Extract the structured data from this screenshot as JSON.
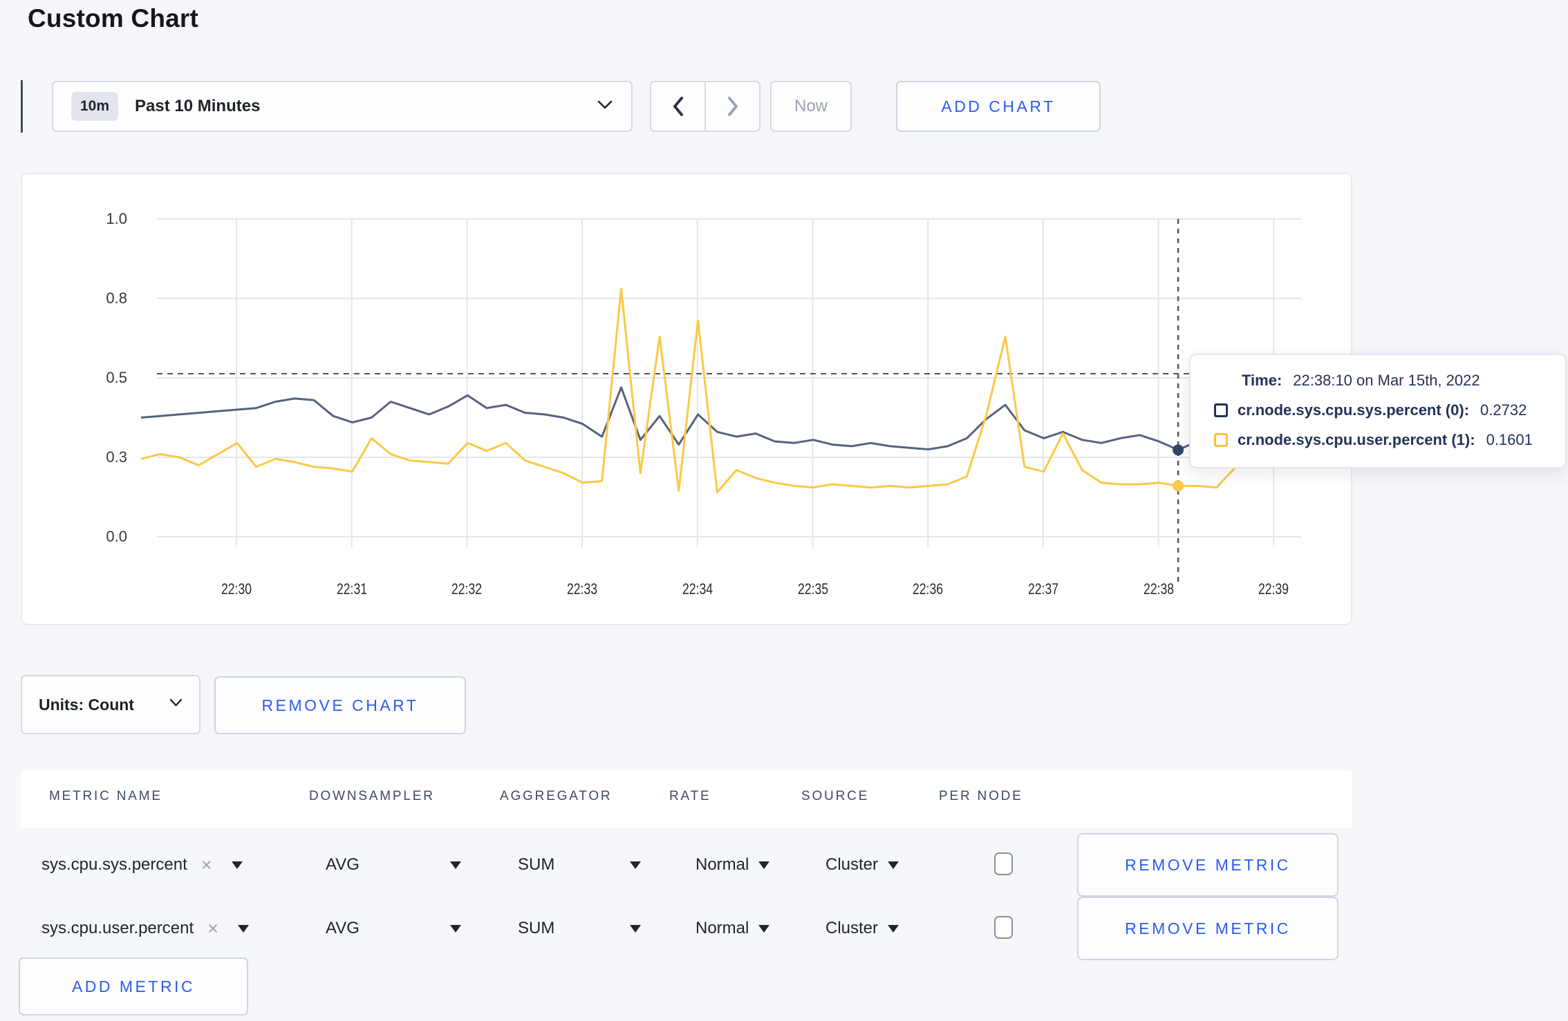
{
  "header": {
    "title": "Custom Chart"
  },
  "toolbar": {
    "range_badge": "10m",
    "range_label": "Past 10 Minutes",
    "now_label": "Now",
    "add_chart_label": "ADD CHART"
  },
  "chart_data": {
    "type": "line",
    "title": "",
    "xlabel": "",
    "ylabel": "",
    "ylim": [
      0,
      1
    ],
    "grid": true,
    "y_ticks": [
      {
        "value": 0.0,
        "label": "0.0"
      },
      {
        "value": 0.25,
        "label": "0.3"
      },
      {
        "value": 0.5,
        "label": "0.5"
      },
      {
        "value": 0.75,
        "label": "0.8"
      },
      {
        "value": 1.0,
        "label": "1.0"
      }
    ],
    "x_ticks": [
      "22:30",
      "22:31",
      "22:32",
      "22:33",
      "22:34",
      "22:35",
      "22:36",
      "22:37",
      "22:38",
      "22:39"
    ],
    "x_start": "22:29:10",
    "x_interval_seconds": 10,
    "guideline_value": 0.513,
    "series": [
      {
        "name": "cr.node.sys.cpu.sys.percent",
        "color": "#56627e",
        "values": [
          0.375,
          0.38,
          0.385,
          0.39,
          0.395,
          0.4,
          0.405,
          0.425,
          0.435,
          0.43,
          0.38,
          0.36,
          0.375,
          0.425,
          0.405,
          0.385,
          0.41,
          0.445,
          0.405,
          0.415,
          0.39,
          0.385,
          0.375,
          0.355,
          0.315,
          0.47,
          0.305,
          0.38,
          0.29,
          0.385,
          0.33,
          0.315,
          0.325,
          0.3,
          0.295,
          0.305,
          0.29,
          0.285,
          0.295,
          0.285,
          0.28,
          0.275,
          0.285,
          0.31,
          0.37,
          0.415,
          0.335,
          0.31,
          0.33,
          0.305,
          0.295,
          0.31,
          0.32,
          0.3,
          0.2732,
          0.3,
          0.295,
          0.3,
          0.31,
          0.295,
          0.305
        ]
      },
      {
        "name": "cr.node.sys.cpu.user.percent",
        "color": "#fcc845",
        "values": [
          0.245,
          0.26,
          0.25,
          0.225,
          0.26,
          0.295,
          0.22,
          0.245,
          0.235,
          0.22,
          0.215,
          0.205,
          0.31,
          0.26,
          0.24,
          0.235,
          0.23,
          0.295,
          0.27,
          0.295,
          0.24,
          0.22,
          0.2,
          0.17,
          0.175,
          0.78,
          0.2,
          0.63,
          0.145,
          0.68,
          0.14,
          0.21,
          0.185,
          0.17,
          0.16,
          0.155,
          0.165,
          0.16,
          0.155,
          0.16,
          0.155,
          0.16,
          0.165,
          0.19,
          0.38,
          0.63,
          0.22,
          0.205,
          0.325,
          0.21,
          0.17,
          0.165,
          0.165,
          0.17,
          0.1601,
          0.16,
          0.155,
          0.22,
          0.285,
          0.255,
          0.275
        ]
      }
    ],
    "crosshair": {
      "index": 54,
      "values": [
        0.2732,
        0.1601
      ]
    }
  },
  "tooltip": {
    "time_label": "Time:",
    "time_value": "22:38:10 on Mar 15th, 2022",
    "rows": [
      {
        "label": "cr.node.sys.cpu.sys.percent (0):",
        "value": "0.2732",
        "color": "#223055"
      },
      {
        "label": "cr.node.sys.cpu.user.percent (1):",
        "value": "0.1601",
        "color": "#fcc13e"
      }
    ]
  },
  "units_row": {
    "units_label": "Units: Count",
    "remove_chart_label": "REMOVE CHART"
  },
  "table": {
    "headers": [
      "METRIC NAME",
      "DOWNSAMPLER",
      "AGGREGATOR",
      "RATE",
      "SOURCE",
      "PER NODE"
    ],
    "metrics": [
      {
        "name": "sys.cpu.sys.percent",
        "downsampler": "AVG",
        "aggregator": "SUM",
        "rate": "Normal",
        "source": "Cluster",
        "per_node_checked": false,
        "remove_label": "REMOVE METRIC"
      },
      {
        "name": "sys.cpu.user.percent",
        "downsampler": "AVG",
        "aggregator": "SUM",
        "rate": "Normal",
        "source": "Cluster",
        "per_node_checked": false,
        "remove_label": "REMOVE METRIC"
      }
    ],
    "add_metric_label": "ADD METRIC"
  },
  "colors": {
    "accent_blue": "#2c5ce8",
    "navy_line": "#56627e",
    "yellow_line": "#fcc845",
    "guideline": "#48556f",
    "gridline": "#e5e6ea"
  }
}
